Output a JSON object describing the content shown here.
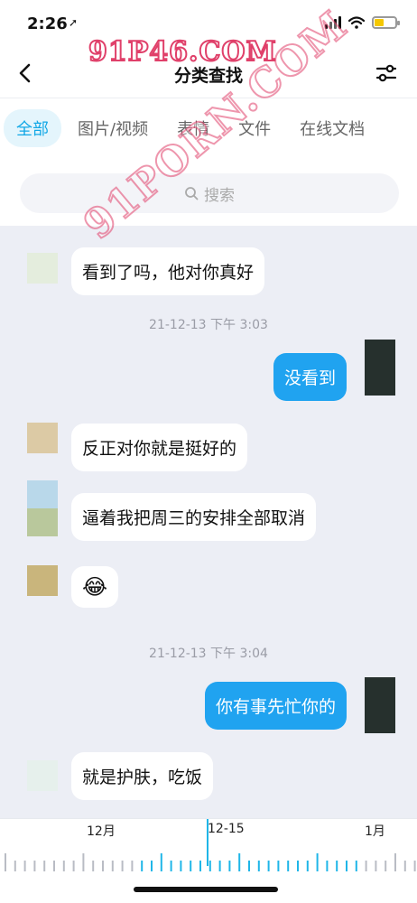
{
  "status_bar": {
    "time": "2:26",
    "location_glyph": "➚"
  },
  "watermarks": {
    "top": "91P46.COM",
    "diagonal": "91PORN.COM"
  },
  "nav": {
    "title": "分类查找"
  },
  "tabs": [
    {
      "label": "全部",
      "active": true
    },
    {
      "label": "图片/视频",
      "active": false
    },
    {
      "label": "表情",
      "active": false
    },
    {
      "label": "文件",
      "active": false
    },
    {
      "label": "在线文档",
      "active": false
    }
  ],
  "search": {
    "placeholder": "搜索"
  },
  "messages": [
    {
      "text": "看到了吗，他对你真好",
      "from": "other",
      "avatar_colors": [
        "#e4eddd"
      ]
    },
    {
      "timestamp": "21-12-13 下午 3:03"
    },
    {
      "text": "没看到",
      "from": "me"
    },
    {
      "text": "反正对你就是挺好的",
      "from": "other",
      "avatar_colors": [
        "#dccaa5"
      ]
    },
    {
      "text": "逼着我把周三的安排全部取消",
      "from": "other",
      "avatar_colors": [
        "#b9d8ea",
        "#b9c89c"
      ]
    },
    {
      "text": "😂",
      "from": "other",
      "avatar_colors": [
        "#c9b57c"
      ]
    },
    {
      "timestamp": "21-12-13 下午 3:04"
    },
    {
      "text": "你有事先忙你的",
      "from": "me"
    },
    {
      "text": "就是护肤，吃饭",
      "from": "other",
      "avatar_colors": [
        "#e6f0ec"
      ]
    }
  ],
  "timeline": {
    "labels": [
      "12月",
      "12-15",
      "1月"
    ],
    "accent": "#1fb6e8"
  }
}
